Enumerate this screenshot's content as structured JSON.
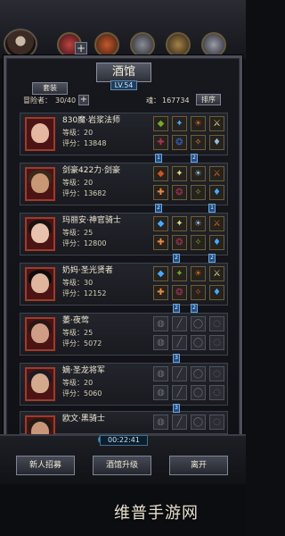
{
  "header": {
    "title": "酒馆",
    "level_badge": "LV.54",
    "tab": "套装",
    "adventurer_label": "冒险者：",
    "adventurer_count": "30/40",
    "plus": "+",
    "soul_label": "魂：",
    "soul_value": "167734",
    "sort_button": "排序"
  },
  "heroes": [
    {
      "name": "830魔·岩浆法师",
      "level": "等级：20",
      "score": "评分：13848",
      "hair": "#4d1414",
      "face": "#e3b7a0"
    },
    {
      "name": "剑豪422力·剑豪",
      "level": "等级：20",
      "score": "评分：13682",
      "hair": "#3a2a1a",
      "face": "#c89774"
    },
    {
      "name": "玛丽安·神官骑士",
      "level": "等级：25",
      "score": "评分：12800",
      "hair": "#1a1210",
      "face": "#e8c2ad"
    },
    {
      "name": "奶妈·圣光贤者",
      "level": "等级：30",
      "score": "评分：12152",
      "hair": "#0e0c0c",
      "face": "#e1b59d"
    },
    {
      "name": "萎·夜莺",
      "level": "等级：25",
      "score": "评分：5072",
      "hair": "#2b1414",
      "face": "#cf9c86"
    },
    {
      "name": "嫡·圣龙将军",
      "level": "等级：20",
      "score": "评分：5060",
      "hair": "#1c1922",
      "face": "#d4a98e"
    },
    {
      "name": "欧文·黑骑士",
      "level": "",
      "score": "",
      "hair": "#221b15",
      "face": "#c9967b"
    }
  ],
  "gem_counts": [
    "1",
    "2",
    "2",
    "1",
    "2",
    "2",
    "2",
    "2",
    "3",
    "3",
    "3"
  ],
  "bottom": {
    "timer": "00:22:41",
    "recruit": "新人招募",
    "upgrade": "酒馆升级",
    "leave": "离开"
  },
  "watermark": "维普手游网"
}
